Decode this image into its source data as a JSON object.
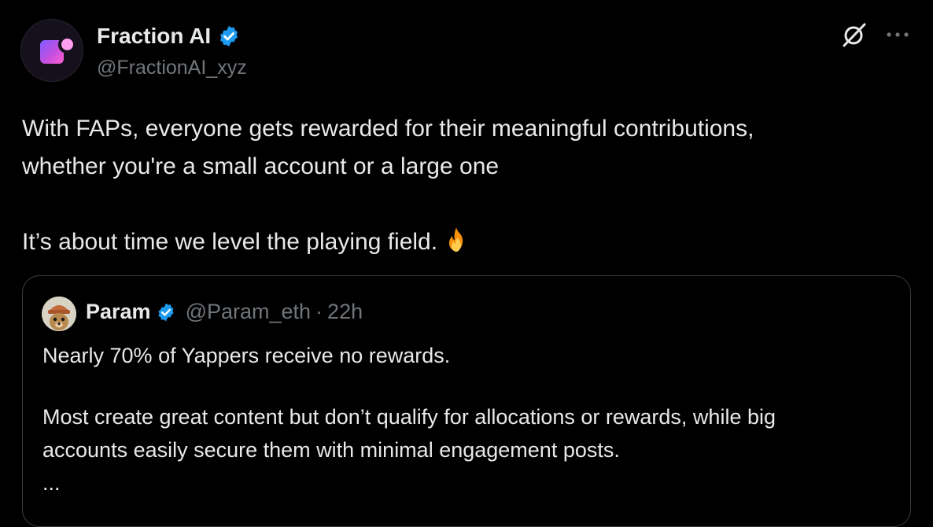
{
  "author": {
    "name": "Fraction AI",
    "handle": "@FractionAI_xyz"
  },
  "tweet": {
    "line1": "With FAPs, everyone gets rewarded for their meaningful contributions,",
    "line2": "whether you're a small account or a large one",
    "line3": "It’s about time we level the playing field.",
    "emoji": "fire-icon"
  },
  "quote": {
    "name": "Param",
    "handle": "@Param_eth",
    "separator": "·",
    "time": "22h",
    "line1": "Nearly 70% of Yappers receive no rewards.",
    "line2": "Most create great content but don’t qualify for allocations or rewards, while big",
    "line3": "accounts easily secure them with minimal engagement posts.",
    "ellipsis": "..."
  },
  "colors": {
    "background": "#000000",
    "text": "#e7e9ea",
    "muted": "#71767b",
    "verified": "#1d9bf0",
    "border": "#3a3d40"
  }
}
